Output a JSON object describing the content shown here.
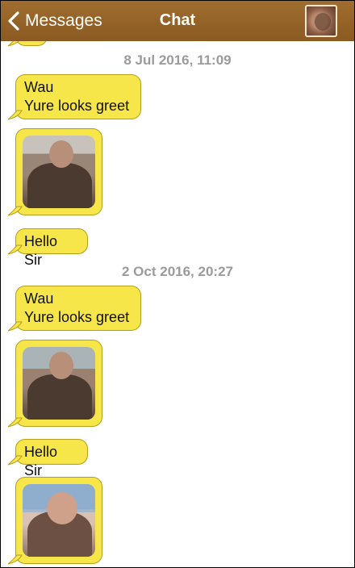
{
  "header": {
    "back_label": "Messages",
    "title": "Chat",
    "colors": {
      "bar": "#8f6026",
      "bubble": "#f7e64a"
    }
  },
  "messages": {
    "timestamp_1": "8 Jul 2016, 11:09",
    "text_1": "Wau\nYure looks greet",
    "text_2": "Hello Sir",
    "timestamp_2": "2 Oct 2016, 20:27",
    "text_3": "Wau\nYure looks greet",
    "text_4": "Hello Sir"
  }
}
